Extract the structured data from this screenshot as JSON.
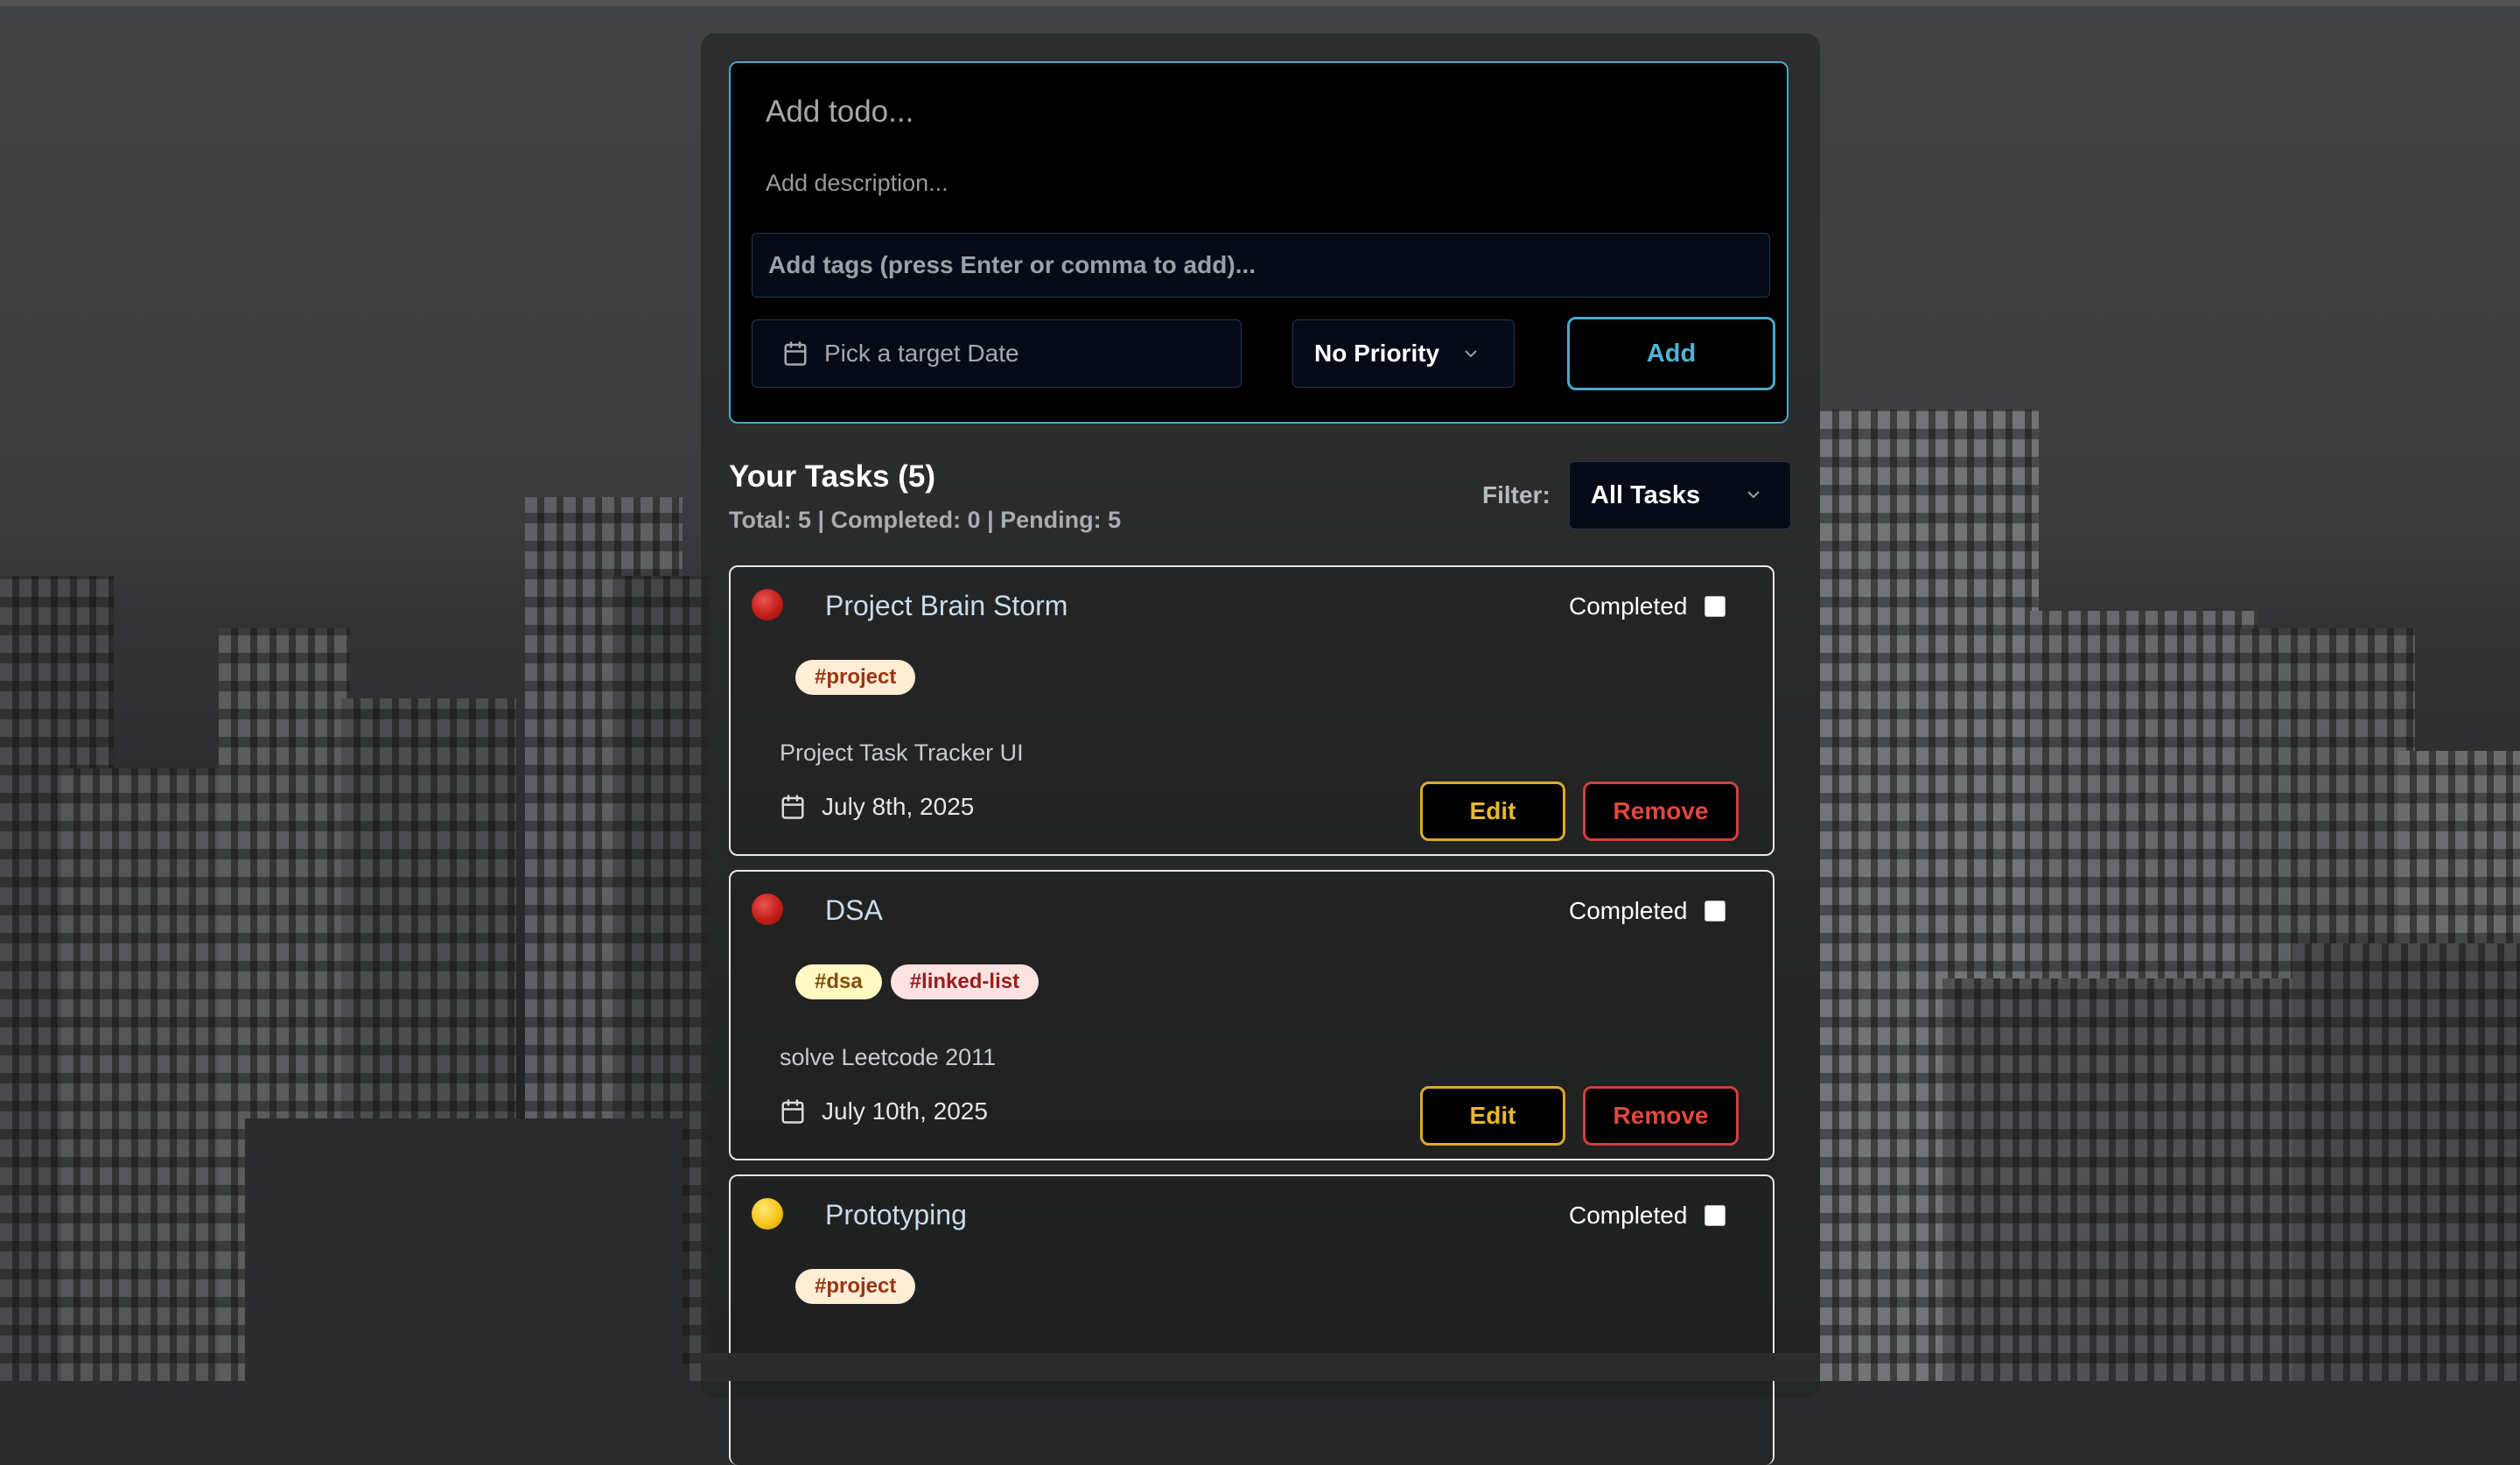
{
  "form": {
    "title_placeholder": "Add todo...",
    "description_placeholder": "Add description...",
    "tags_placeholder": "Add tags (press Enter or comma to add)...",
    "date_placeholder": "Pick a target Date",
    "priority_value": "No Priority",
    "add_label": "Add"
  },
  "tasks_header": {
    "title": "Your Tasks (5)",
    "stats": "Total: 5 | Completed: 0 | Pending: 5",
    "filter_label": "Filter:",
    "filter_value": "All Tasks"
  },
  "tasks": [
    {
      "priority_color": "#c41d1a",
      "title": "Project Brain Storm",
      "completed_label": "Completed",
      "tags": [
        "#project"
      ],
      "description": "Project Task Tracker UI",
      "date": "July 8th, 2025",
      "edit_label": "Edit",
      "remove_label": "Remove"
    },
    {
      "priority_color": "#c41d1a",
      "title": "DSA",
      "completed_label": "Completed",
      "tags": [
        "#dsa",
        "#linked-list"
      ],
      "description": "solve Leetcode 2011",
      "date": "July 10th, 2025",
      "edit_label": "Edit",
      "remove_label": "Remove"
    },
    {
      "priority_color": "#f5c518",
      "title": "Prototyping",
      "completed_label": "Completed",
      "tags": [
        "#project"
      ]
    }
  ],
  "colors": {
    "accent": "#4aa8c8",
    "edit": "#d9aa2c",
    "remove": "#d13f3f"
  },
  "icons": {
    "date": "calendar-icon",
    "dropdown": "chevron-down-icon"
  }
}
